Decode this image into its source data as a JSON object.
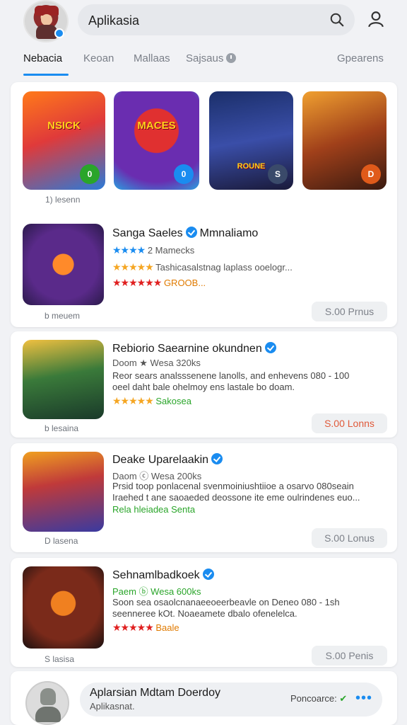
{
  "header": {
    "search_value": "Aplikasia",
    "search_icon": "search-icon",
    "profile_icon": "person-icon",
    "avatar_badge_color": "#1a8cf0"
  },
  "tabs": [
    {
      "label": "Nebacia",
      "active": true
    },
    {
      "label": "Keoan",
      "active": false
    },
    {
      "label": "Mallaas",
      "active": false
    },
    {
      "label": "Sajsaus",
      "active": false
    },
    {
      "label": "Gpearens",
      "active": false
    }
  ],
  "featured": {
    "games": [
      {
        "title": "NSICK",
        "badge": "0",
        "badge_color": "#2aa52a"
      },
      {
        "title": "MACES",
        "badge": "0",
        "badge_color": "#1a8cf0"
      },
      {
        "title": "ROUNE",
        "badge": "S",
        "badge_color": "#3a4a6a"
      },
      {
        "title": "",
        "badge": "D",
        "badge_color": "#e05a1a"
      }
    ],
    "caption": "1) lesenn"
  },
  "featured_row": {
    "title": "Sanga Saeles",
    "verified_suffix": "Mmnaliamo",
    "rating_meta": "2 Mamecks",
    "desc": "Tashicasalstnag laplass ooelogr...",
    "price_note": "GROOB...",
    "caption": "b meuem",
    "price": "S.00 Prnus"
  },
  "list": [
    {
      "title": "Rebiorio Saearnine okundnen",
      "meta": "Doom ★ Wesa 320ks",
      "desc": "Reor sears analsssenene lanolls, and enhevens 080 - 100 oeel daht bale ohelmoy ens lastale bo doam.",
      "tag": "Sakosea",
      "tag_color": "#2aa52a",
      "caption": "b lesaina",
      "price": "S.00 Lonns",
      "price_hot": true
    },
    {
      "title": "Deake Uparelaakin",
      "meta": "Daom ⓒ Wesa 200ks",
      "desc": "Prsid toop ponlacenal svenmoiniushtiioe a osarvo 080seain Iraehed t ane saoaeded deossone ite eme oulrindenes euo...",
      "tag": "Rela hleiadea  Senta",
      "tag_color": "#2aa52a",
      "caption": "D lasena",
      "price": "S.00 Lonus",
      "price_hot": false
    },
    {
      "title": "Sehnamlbadkoek",
      "meta": "Paem ⓑ Wesa 600ks",
      "desc": "Soon sea osaolcnanaeeoeerbeavle on Deneo 080 - 1sh seenneree kOt. Noaeamete dbalo ofenelelca.",
      "tag": "Baale",
      "tag_color": "#e07a00",
      "caption": "S lasisa",
      "price": "S.00 Penis",
      "price_hot": false
    }
  ],
  "bottom": {
    "title": "Aplarsian Mdtam Doerdoy",
    "subtitle": "Aplikasnat.",
    "action": "Poncoarce:",
    "more_icon": "more-dots-icon"
  }
}
